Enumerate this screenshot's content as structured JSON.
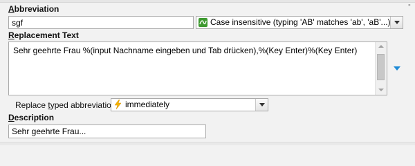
{
  "abbreviation": {
    "label_underlined": "A",
    "label_rest": "bbreviation",
    "value": "sgf"
  },
  "case_mode": {
    "icon": "case-sensitivity-icon",
    "selected": "Case insensitive (typing 'AB' matches 'ab', 'aB'...)"
  },
  "replacement": {
    "label_underlined": "R",
    "label_rest": "eplacement Text",
    "value": "Sehr geehrte Frau %(input Nachname eingeben und Tab drücken),%(Key Enter)%(Key Enter)"
  },
  "replace_typed": {
    "label_pre": "Replace ",
    "label_underlined": "t",
    "label_post": "yped abbreviation:",
    "icon": "lightning-bolt-icon",
    "selected": "immediately"
  },
  "description": {
    "label_underlined": "D",
    "label_rest": "escription",
    "value": "Sehr geehrte Frau..."
  },
  "colors": {
    "accent": "#1e8ad6",
    "case_icon": "#3e9a30",
    "bolt": "#f5b400"
  }
}
